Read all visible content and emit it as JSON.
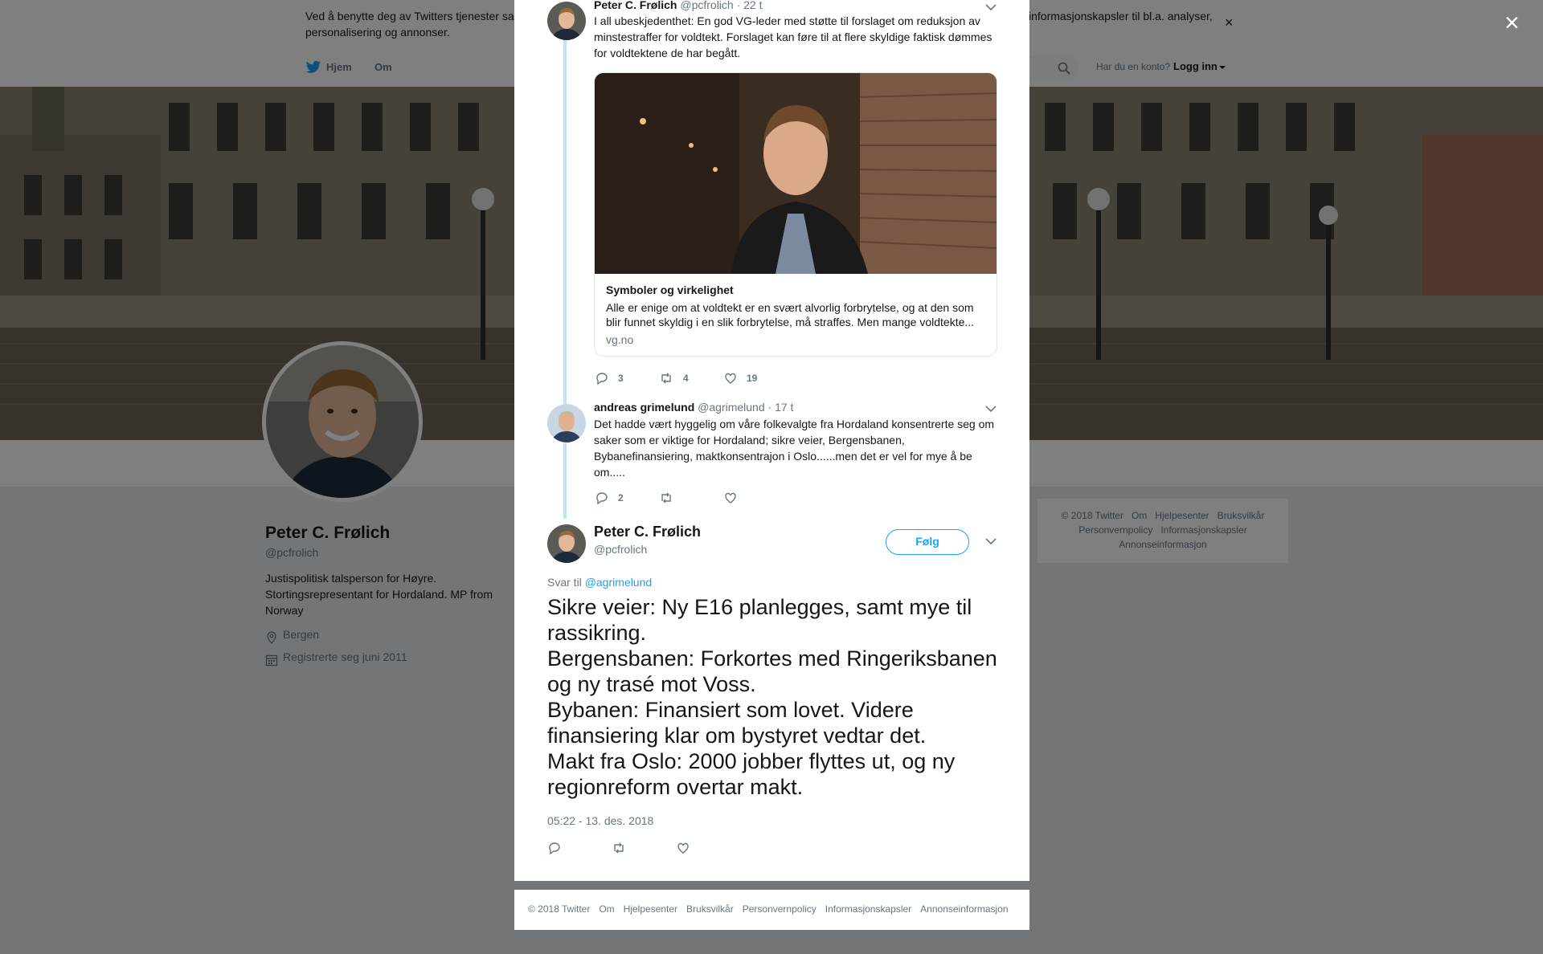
{
  "cookie_notice": {
    "text_left": "Ved å benytte deg av Twitters tjenester sa",
    "text_line2": "personalisering og annonser.",
    "text_right": "informasjonskapsler til bl.a. analyser,",
    "close": "×"
  },
  "nav": {
    "home": "Hjem",
    "about": "Om",
    "login_question": "Har du en konto?",
    "login_link": "Logg inn"
  },
  "profile": {
    "name": "Peter C. Frølich",
    "handle": "@pcfrolich",
    "bio": "Justispolitisk talsperson for Høyre. Stortingsrepresentant for Hordaland. MP from Norway",
    "location": "Bergen",
    "joined": "Registrerte seg juni 2011"
  },
  "side_footer": {
    "line1": [
      "© 2018 Twitter",
      "Om",
      "Hjelpesenter",
      "Bruksvilkår"
    ],
    "line2": [
      "Personvernpolicy",
      "Informasjonskapsler"
    ],
    "line3": [
      "Annonseinformasjon"
    ]
  },
  "overlay_close": "×",
  "tweet1": {
    "name": "Peter C. Frølich",
    "handle": "@pcfrolich",
    "time": "· 22 t",
    "text": "I all ubeskjedenthet: En god VG-leder med støtte til forslaget om reduksjon av minstestraffer for voldtekt. Forslaget kan føre til at flere skyldige faktisk dømmes for voldtektene de har begått.",
    "card": {
      "title": "Symboler og virkelighet",
      "description": "Alle er enige om at voldtekt er en svært alvorlig forbrytelse, og at den som blir funnet skyldig i en slik forbrytelse, må straffes. Men mange voldtekte...",
      "domain": "vg.no"
    },
    "replies": "3",
    "retweets": "4",
    "likes": "19"
  },
  "tweet2": {
    "name": "andreas grimelund",
    "handle": "@agrimelund",
    "time": "· 17 t",
    "text": "Det hadde vært hyggelig om våre folkevalgte fra Hordaland konsentrerte seg om saker som er viktige for Hordaland; sikre veier, Bergensbanen, Bybanefinansiering, maktkonsentrajon i Oslo......men det er vel for mye å be om.....",
    "replies": "2"
  },
  "main_tweet": {
    "name": "Peter C. Frølich",
    "handle": "@pcfrolich",
    "follow": "Følg",
    "reply_prefix": "Svar til",
    "reply_handle": "@agrimelund",
    "text": "Sikre veier: Ny E16 planlegges, samt mye til rassikring.\nBergensbanen: Forkortes med Ringeriksbanen og ny trasé mot Voss.\nBybanen: Finansiert som lovet. Videre finansiering klar om bystyret vedtar det.\nMakt fra Oslo: 2000 jobber flyttes ut, og ny regionreform overtar makt.",
    "timestamp": "05:22 - 13. des. 2018"
  },
  "modal_footer": [
    "© 2018 Twitter",
    "Om",
    "Hjelpesenter",
    "Bruksvilkår",
    "Personvernpolicy",
    "Informasjonskapsler",
    "Annonseinformasjon"
  ],
  "colors": {
    "twitter_blue": "#1da1f2",
    "thread_line": "#bfe3f6",
    "text_secondary": "#657786",
    "overlay": "rgba(0,0,0,0.5)"
  },
  "icons": [
    "twitter-bird-icon",
    "search-icon",
    "caret-down-icon",
    "location-icon",
    "calendar-icon",
    "reply-icon",
    "retweet-icon",
    "like-icon",
    "close-icon"
  ]
}
